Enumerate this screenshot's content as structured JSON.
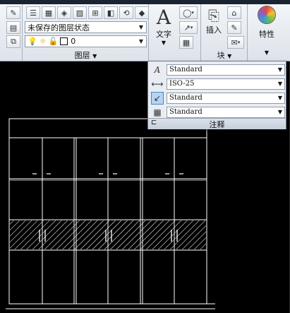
{
  "layer_group": {
    "state_value": "未保存的图层状态",
    "current_layer_value": "0",
    "label": "图层"
  },
  "annotation_group": {
    "text_label": "文字",
    "panel_label": "注释",
    "text_style": "Standard",
    "dim_style": "ISO-25",
    "mleader_style": "Standard",
    "table_style": "Standard"
  },
  "block_group": {
    "insert_label": "插入",
    "label": "块"
  },
  "properties_group": {
    "label": "特性"
  },
  "icons": [
    "brush-icon",
    "layer-tools-icon",
    "text-A-icon",
    "circle-icon",
    "insert-block-icon",
    "color-wheel-icon",
    "pin-icon"
  ],
  "colors": {
    "canvas": "#000000",
    "drawing_lines": "#ffffff",
    "ribbon": "#e3e8ee",
    "highlight": "#b7d3f2"
  }
}
